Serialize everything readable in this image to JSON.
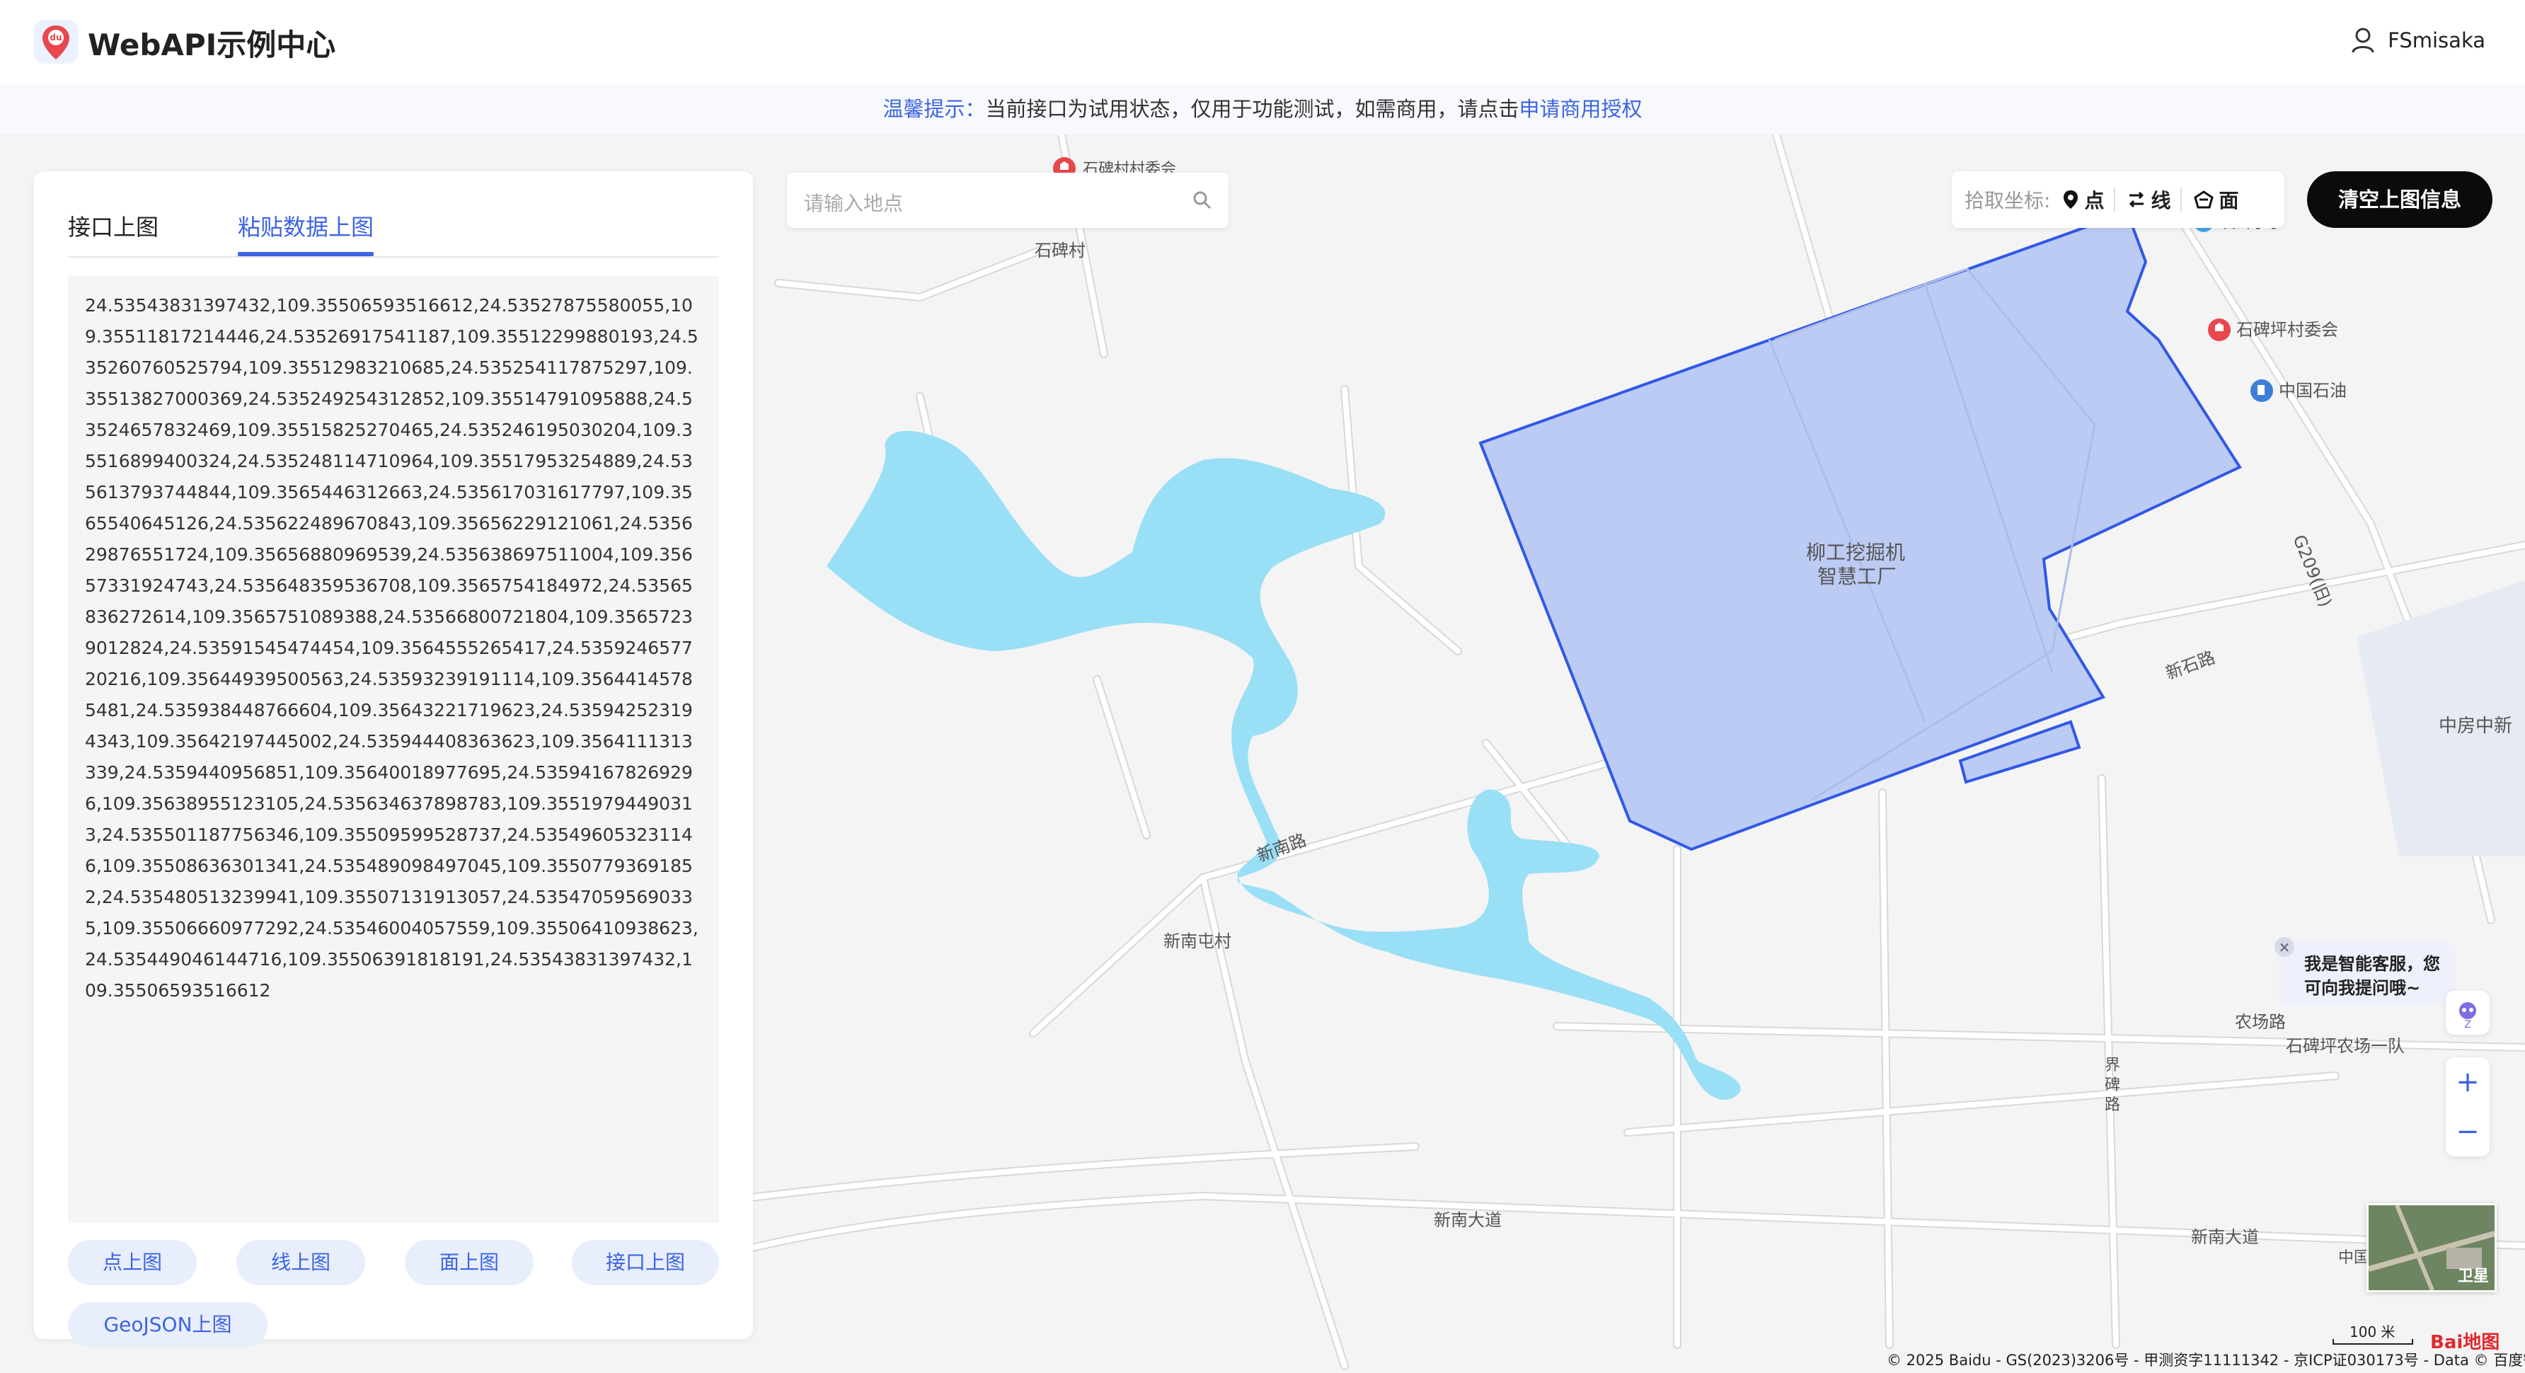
{
  "header": {
    "app_title": "WebAPI示例中心",
    "logo_badge": "du",
    "user_name": "FSmisaka"
  },
  "notice": {
    "prefix": "温馨提示：",
    "text": "当前接口为试用状态，仅用于功能测试，如需商用，请点击",
    "link": "申请商用授权"
  },
  "panel": {
    "tabs": [
      {
        "label": "接口上图",
        "active": false
      },
      {
        "label": "粘贴数据上图",
        "active": true
      }
    ],
    "textarea_value": "24.53543831397432,109.35506593516612,24.53527875580055,109.35511817214446,24.53526917541187,109.35512299880193,24.535260760525794,109.35512983210685,24.535254117875297,109.35513827000369,24.535249254312852,109.35514791095888,24.53524657832469,109.35515825270465,24.535246195030204,109.35516899400324,24.535248114710964,109.35517953254889,24.535613793744844,109.3565446312663,24.535617031617797,109.3565540645126,24.535622489670843,109.35656229121061,24.535629876551724,109.35656880969539,24.535638697511004,109.35657331924743,24.535648359536708,109.3565754184972,24.53565836272614,109.3565751089388,24.53566800721804,109.35657239012824,24.53591545474454,109.3564555265417,24.535924657720216,109.35644939500563,24.53593239191114,109.35644145785481,24.535938448766604,109.35643221719623,24.535942523194343,109.35642197445002,24.535944408363623,109.3564111313339,24.5359440956851,109.35640018977695,24.535941678269296,109.35638955123105,24.535634637898783,109.35519794490313,24.535501187756346,109.35509599528737,24.535496053231146,109.35508636301341,24.535489098497045,109.35507793691852,24.535480513239941,109.35507131913057,24.535470595690335,109.35506660977292,24.53546004057559,109.35506410938623,24.535449046144716,109.35506391818191,24.53543831397432,109.35506593516612",
    "buttons": [
      "点上图",
      "线上图",
      "面上图",
      "接口上图",
      "GeoJSON上图"
    ]
  },
  "search": {
    "placeholder": "请输入地点"
  },
  "pick": {
    "label": "拾取坐标:",
    "items": [
      {
        "label": "点",
        "icon": "pin-icon"
      },
      {
        "label": "线",
        "icon": "line-icon"
      },
      {
        "label": "面",
        "icon": "polygon-icon"
      }
    ]
  },
  "clear_button": "清空上图信息",
  "assistant": {
    "line1": "我是智能客服，您",
    "line2": "可向我提问哦~",
    "close": "×"
  },
  "zoom": {
    "in": "+",
    "out": "−"
  },
  "thumbnail_label": "卫星",
  "scale_label": "100 米",
  "baidu_logo": "Bai地图",
  "copyright": "© 2025 Baidu - GS(2023)3206号 - 甲测资字11111342 - 京ICP证030173号 - Data © 百度智图",
  "map_labels": {
    "village_committee_top": "石碑村村委会",
    "village": "石碑村",
    "school": "石碑小学",
    "shibeiping_committee": "石碑坪村委会",
    "petrochina": "中国石油",
    "factory_l1": "柳工挖掘机",
    "factory_l2": "智慧工厂",
    "road_g209": "G209(旧)",
    "road_xinshi": "新石路",
    "road_xinnan": "新南路",
    "village_xinnantun": "新南屯村",
    "zhongfang": "中房中新",
    "road_farm": "农场路",
    "farm_team": "石碑坪农场一队",
    "road_jiebei": "界碑路",
    "road_xinnan_ave1": "新南大道",
    "road_xinnan_ave2": "新南大道",
    "china_label": "中国"
  },
  "colors": {
    "accent": "#3d64e2",
    "water": "#99dff6",
    "polygon_fill": "#bccbf3",
    "polygon_stroke": "#3158e6",
    "poi_red": "#e8474d"
  }
}
